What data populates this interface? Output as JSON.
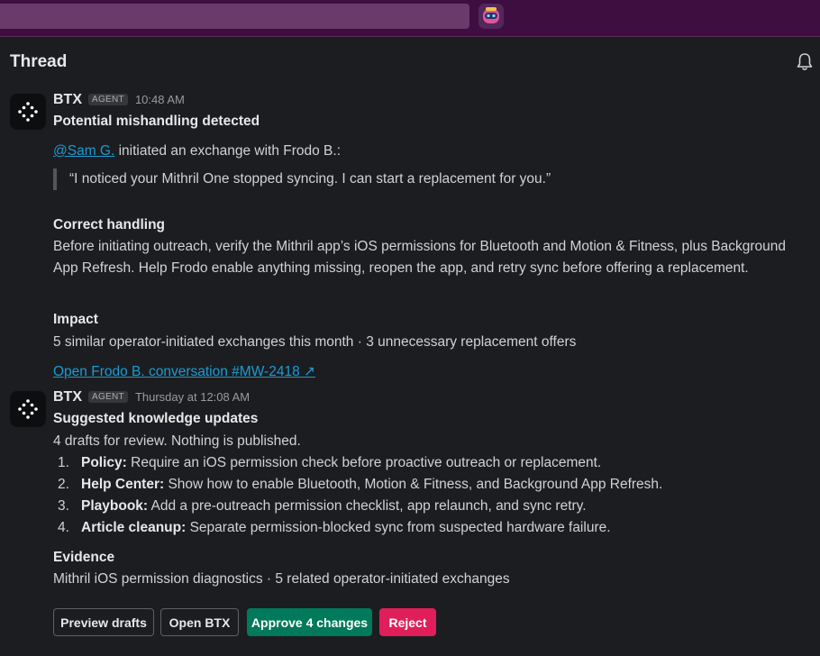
{
  "thread": {
    "title": "Thread",
    "bell_icon": "bell-icon"
  },
  "messages": [
    {
      "sender": "BTX",
      "badge": "AGENT",
      "time": "10:48 AM",
      "heading": "Potential mishandling detected",
      "mention": "@Sam G.",
      "mention_rest": " initiated an exchange with Frodo B.:",
      "quote": "“I noticed your Mithril One stopped syncing. I can start a replacement for you.”",
      "correct_title": "Correct handling",
      "correct_text": "Before initiating outreach, verify the Mithril app’s iOS permissions for Bluetooth and Motion & Fitness, plus Background App Refresh. Help Frodo enable anything missing, reopen the app, and retry sync before offering a replacement.",
      "impact_title": "Impact",
      "impact_text": "5 similar operator-initiated exchanges this month · 3 unnecessary replacement offers",
      "link_text": "Open Frodo B. conversation #MW-2418 ↗"
    },
    {
      "sender": "BTX",
      "badge": "AGENT",
      "time": "Thursday at 12:08 AM",
      "heading": "Suggested knowledge updates",
      "intro": "4 drafts for review. Nothing is published.",
      "items": [
        {
          "num": "1.",
          "label": "Policy:",
          "text": " Require an iOS permission check before proactive outreach or replacement."
        },
        {
          "num": "2.",
          "label": "Help Center:",
          "text": " Show how to enable Bluetooth, Motion & Fitness, and Background App Refresh."
        },
        {
          "num": "3.",
          "label": "Playbook:",
          "text": " Add a pre-outreach permission checklist, app relaunch, and sync retry."
        },
        {
          "num": "4.",
          "label": "Article cleanup:",
          "text": " Separate permission-blocked sync from suspected hardware failure."
        }
      ],
      "evidence_title": "Evidence",
      "evidence_text": "Mithril iOS permission diagnostics · 5 related operator-initiated exchanges"
    }
  ],
  "actions": {
    "preview": "Preview drafts",
    "open": "Open BTX",
    "approve": "Approve 4 changes",
    "reject": "Reject",
    "approve_color": "#007a5a",
    "reject_color": "#e01e5a"
  }
}
